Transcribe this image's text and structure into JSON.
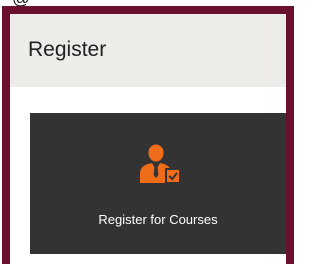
{
  "top_strip": {
    "glyphs": "@"
  },
  "panel": {
    "title": "Register",
    "tile": {
      "icon": "user-check-icon",
      "label": "Register for Courses"
    }
  },
  "colors": {
    "frame": "#6b0f2e",
    "header_bg": "#eeece9",
    "tile_bg": "#333333",
    "icon_accent": "#ef6c1a"
  }
}
